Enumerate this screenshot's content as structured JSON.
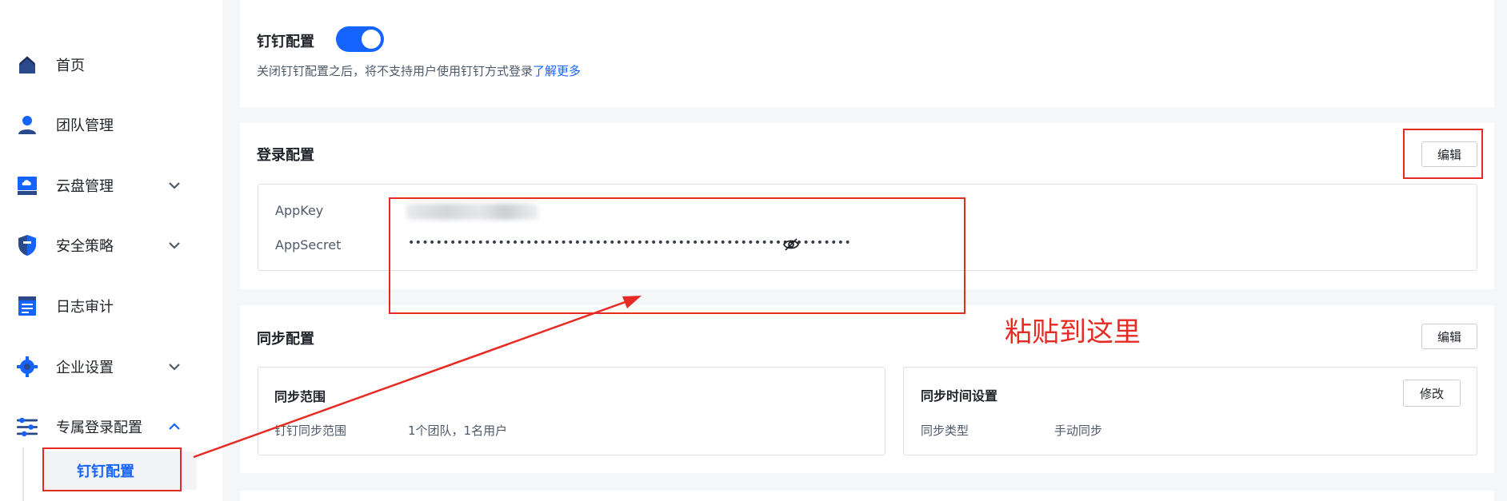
{
  "sidebar": {
    "items": [
      {
        "label": "首页",
        "icon": "home-icon"
      },
      {
        "label": "团队管理",
        "icon": "user-icon"
      },
      {
        "label": "云盘管理",
        "icon": "cloud-disk-icon"
      },
      {
        "label": "安全策略",
        "icon": "shield-icon"
      },
      {
        "label": "日志审计",
        "icon": "log-icon"
      },
      {
        "label": "企业设置",
        "icon": "gear-icon"
      },
      {
        "label": "专属登录配置",
        "icon": "sliders-icon"
      }
    ],
    "sub_item": {
      "label": "钉钉配置"
    }
  },
  "dingtalk": {
    "title": "钉钉配置",
    "desc": "关闭钉钉配置之后，将不支持用户使用钉钉方式登录",
    "learn_more": "了解更多"
  },
  "login": {
    "title": "登录配置",
    "edit": "编辑",
    "appkey_label": "AppKey",
    "appsecret_label": "AppSecret",
    "appsecret_masked": "••••••••••••••••••••••••••••••••••••••••••••••••••••••••••••••••"
  },
  "sync": {
    "title": "同步配置",
    "edit": "编辑",
    "range": {
      "title": "同步范围",
      "label": "钉钉同步范围",
      "value": "1个团队，1名用户"
    },
    "time": {
      "title": "同步时间设置",
      "modify": "修改",
      "label": "同步类型",
      "value": "手动同步"
    }
  },
  "annotation": {
    "text": "粘贴到这里",
    "color": "#e62b24"
  },
  "colors": {
    "accent": "#1664ff"
  }
}
